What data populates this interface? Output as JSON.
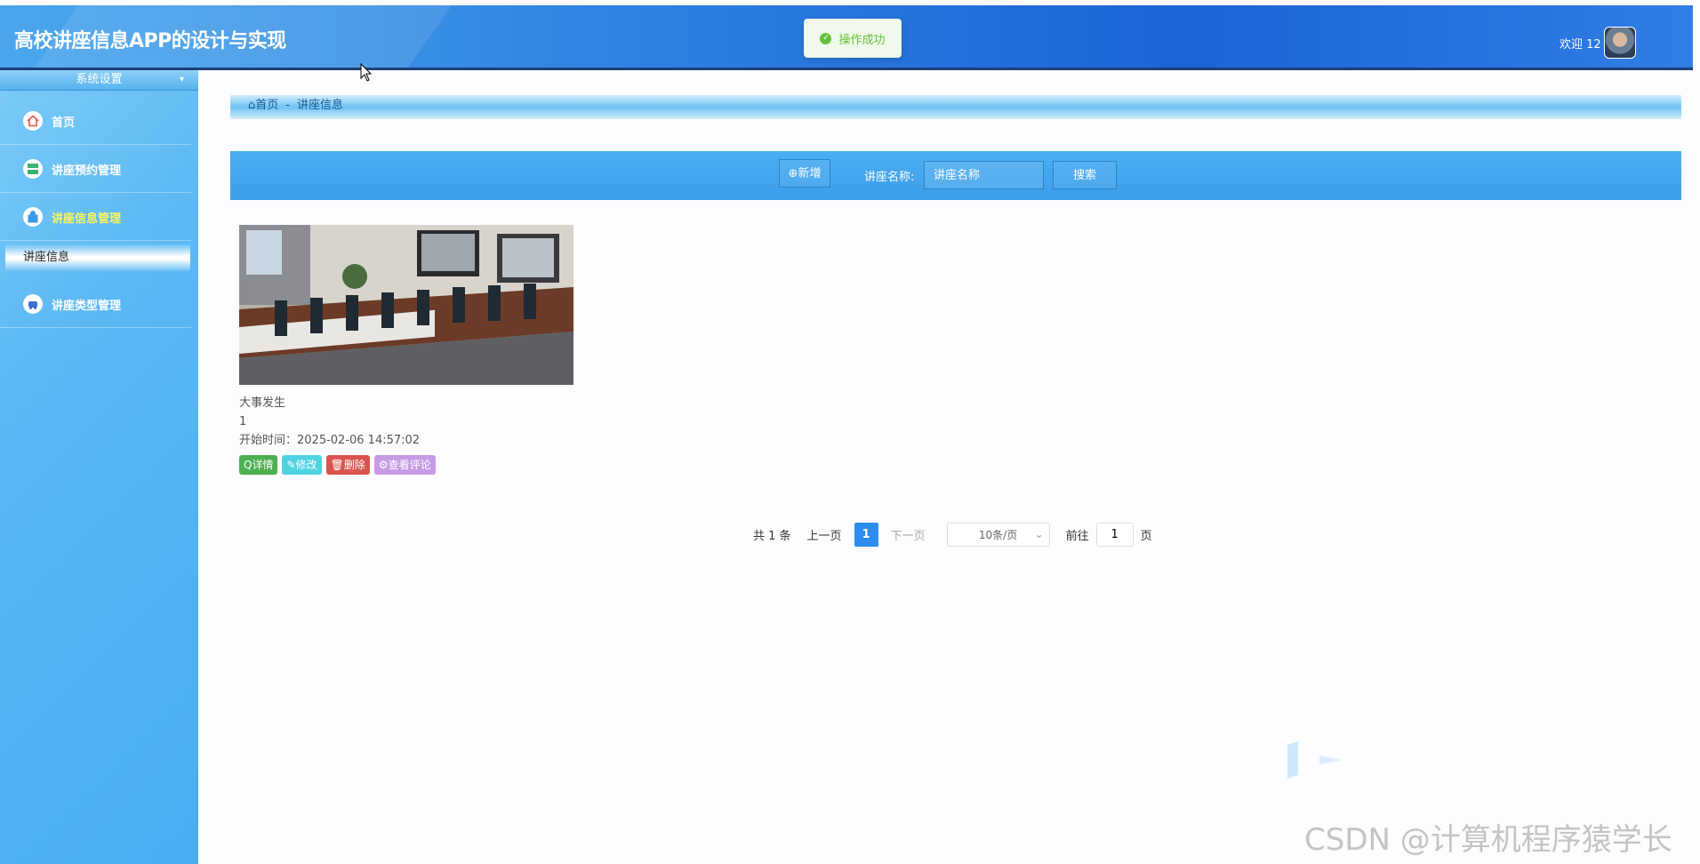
{
  "header": {
    "app_title": "高校讲座信息APP的设计与实现",
    "welcome": "欢迎 12",
    "toast": "操作成功"
  },
  "sidebar": {
    "title": "系统设置",
    "items": [
      {
        "label": "首页",
        "icon": "home-icon"
      },
      {
        "label": "讲座预约管理",
        "icon": "grid-icon"
      },
      {
        "label": "讲座信息管理",
        "icon": "bag-icon",
        "active": true
      },
      {
        "label": "讲座类型管理",
        "icon": "car-icon"
      }
    ],
    "submenu": "讲座信息"
  },
  "breadcrumb": {
    "home": "首页",
    "sep": "-",
    "current": "讲座信息"
  },
  "toolbar": {
    "add_label": "⊕新增",
    "search_label": "讲座名称:",
    "search_placeholder": "讲座名称",
    "search_button": "搜索"
  },
  "cards": [
    {
      "title": "大事发生",
      "number": "1",
      "start_time": "开始时间：2025-02-06 14:57:02",
      "actions": {
        "detail": "详情",
        "edit": "修改",
        "delete": "删除",
        "comments": "查看评论"
      }
    }
  ],
  "pagination": {
    "total": "共 1 条",
    "prev": "上一页",
    "current": "1",
    "next": "下一页",
    "page_size": "10条/页",
    "goto_label": "前往",
    "goto_value": "1",
    "page_suffix": "页"
  },
  "watermark": "CSDN @计算机程序猿学长",
  "colors": {
    "header": "#2d7fe0",
    "sidebar": "#5ab8f3",
    "detail": "#4caf50",
    "edit": "#4fd3e3",
    "delete": "#d9534f",
    "comments": "#c79be6",
    "success": "#67c23a"
  }
}
